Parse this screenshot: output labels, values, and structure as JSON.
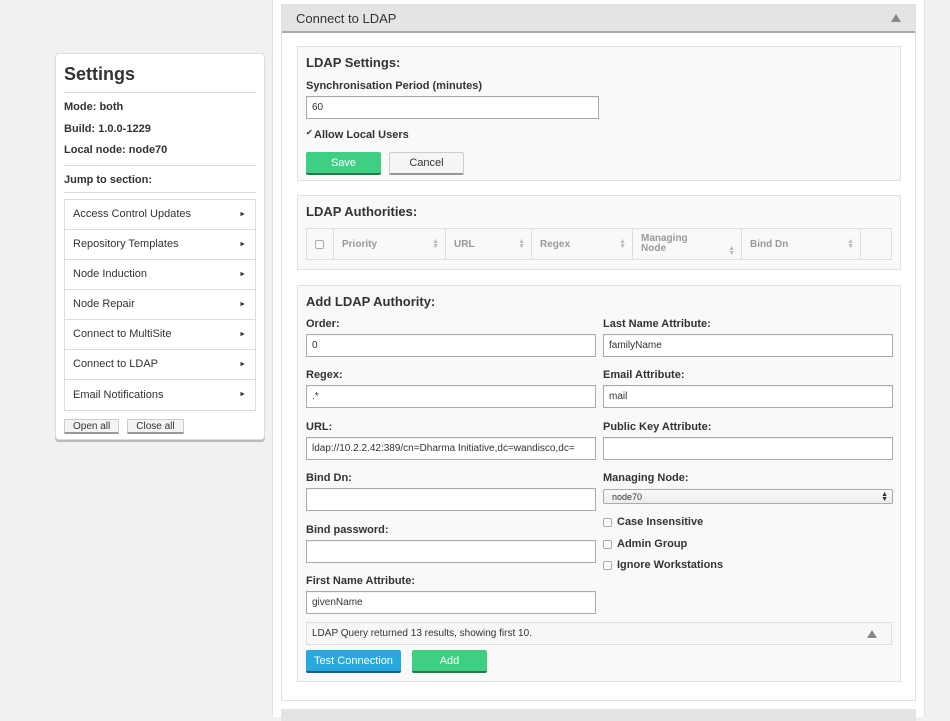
{
  "settings": {
    "title": "Settings",
    "mode": "Mode: both",
    "build": "Build: 1.0.0-1229",
    "local_node": "Local node: node70",
    "jump_label": "Jump to section:",
    "nav_items": [
      {
        "label": "Access Control Updates",
        "icon": "triangle-right-icon"
      },
      {
        "label": "Repository Templates",
        "icon": "triangle-right-icon"
      },
      {
        "label": "Node Induction",
        "icon": "triangle-right-icon"
      },
      {
        "label": "Node Repair",
        "icon": "triangle-right-icon"
      },
      {
        "label": "Connect to MultiSite",
        "icon": "triangle-right-icon"
      },
      {
        "label": "Connect to LDAP",
        "icon": "triangle-right-icon"
      },
      {
        "label": "Email Notifications",
        "icon": "triangle-right-icon"
      }
    ],
    "open_all": "Open all",
    "close_all": "Close all"
  },
  "panel": {
    "title": "Connect to LDAP",
    "collapse_icon": "triangle-up-icon"
  },
  "ldap_settings": {
    "heading": "LDAP Settings:",
    "sync_label": "Synchronisation Period (minutes)",
    "sync_value": "60",
    "allow_local_users_label": "Allow Local Users",
    "allow_local_users_checked": true,
    "save": "Save",
    "cancel": "Cancel"
  },
  "authorities": {
    "heading": "LDAP Authorities:",
    "columns": [
      "Priority",
      "URL",
      "Regex",
      "Managing Node",
      "Bind Dn"
    ],
    "rows": []
  },
  "add_authority": {
    "heading": "Add LDAP Authority:",
    "order_label": "Order:",
    "order_value": "0",
    "regex_label": "Regex:",
    "regex_value": ".*",
    "url_label": "URL:",
    "url_value": "ldap://10.2.2.42:389/cn=Dharma Initiative,dc=wandisco,dc=",
    "bind_dn_label": "Bind Dn:",
    "bind_dn_value": "",
    "bind_password_label": "Bind password:",
    "bind_password_value": "",
    "first_name_label": "First Name Attribute:",
    "first_name_value": "givenName",
    "last_name_label": "Last Name Attribute:",
    "last_name_value": "familyName",
    "email_label": "Email Attribute:",
    "email_value": "mail",
    "public_key_label": "Public Key Attribute:",
    "public_key_value": "",
    "managing_node_label": "Managing Node:",
    "managing_node_value": "node70",
    "case_insensitive_label": "Case Insensitive",
    "admin_group_label": "Admin Group",
    "ignore_workstations_label": "Ignore Workstations",
    "query_result": "LDAP Query returned 13 results, showing first 10.",
    "test_connection": "Test Connection",
    "add": "Add"
  }
}
